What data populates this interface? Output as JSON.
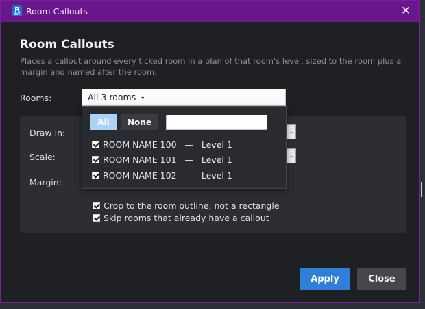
{
  "window": {
    "title": "Room Callouts",
    "app_icon_letter": "R",
    "app_icon_sub": "RVT",
    "close_glyph": "✕"
  },
  "heading": "Room Callouts",
  "description": "Places a callout around every ticked room in a plan of that room's level, sized to the room plus a margin and named after the room.",
  "rooms": {
    "label": "Rooms:",
    "selected": "All 3 rooms",
    "caret": "▾"
  },
  "settings": {
    "draw_in_label": "Draw in:",
    "scale_label": "Scale:",
    "margin_label": "Margin:",
    "dropdown_glyph": "⌄",
    "options": [
      {
        "label": "Crop to the room outline, not a rectangle",
        "checked": true
      },
      {
        "label": "Skip rooms that already have a callout",
        "checked": true
      }
    ]
  },
  "room_list": {
    "all_label": "All",
    "none_label": "None",
    "filter_value": "",
    "items": [
      {
        "text": "ROOM NAME 100   —   Level 1",
        "checked": true
      },
      {
        "text": "ROOM NAME 101   —   Level 1",
        "checked": true
      },
      {
        "text": "ROOM NAME 102   —   Level 1",
        "checked": true
      }
    ]
  },
  "actions": {
    "apply_label": "Apply",
    "close_label": "Close"
  },
  "colors": {
    "titlebar": "#6a168c",
    "accent": "#2f7fd8",
    "all_button": "#a9d4f6"
  }
}
